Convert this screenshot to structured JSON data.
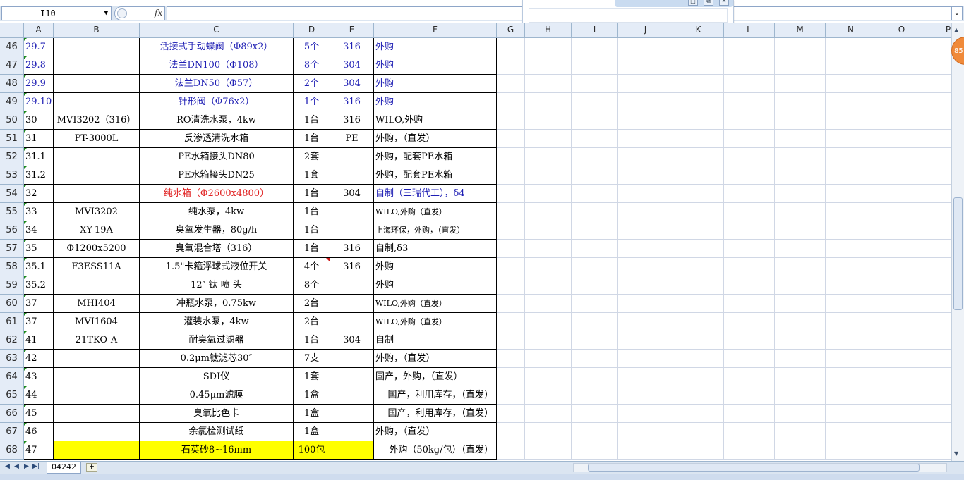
{
  "formula_bar": {
    "name_box": "I10",
    "fx_label": "fx",
    "formula": ""
  },
  "popup": {
    "buttons": [
      "□",
      "⧉",
      "✕"
    ]
  },
  "columns": [
    "A",
    "B",
    "C",
    "D",
    "E",
    "F",
    "G",
    "H",
    "I",
    "J",
    "K",
    "L",
    "M",
    "N",
    "O",
    "P"
  ],
  "rows": [
    {
      "n": "46",
      "a": "29.7",
      "b": "",
      "c": "活接式手动蝶阀（Φ89x2）",
      "d": "5个",
      "e": "316",
      "f": "外购",
      "blue": true
    },
    {
      "n": "47",
      "a": "29.8",
      "b": "",
      "c": "法兰DN100（Φ108）",
      "d": "8个",
      "e": "304",
      "f": "外购",
      "blue": true
    },
    {
      "n": "48",
      "a": "29.9",
      "b": "",
      "c": "法兰DN50（Φ57）",
      "d": "2个",
      "e": "304",
      "f": "外购",
      "blue": true
    },
    {
      "n": "49",
      "a": "29.10",
      "b": "",
      "c": "针形阀（Φ76x2）",
      "d": "1个",
      "e": "316",
      "f": "外购",
      "blue": true
    },
    {
      "n": "50",
      "a": "30",
      "b": "MVI3202（316）",
      "c": "RO清洗水泵，4kw",
      "d": "1台",
      "e": "316",
      "f": "WILO,外购"
    },
    {
      "n": "51",
      "a": "31",
      "b": "PT-3000L",
      "c": "反渗透清洗水箱",
      "d": "1台",
      "e": "PE",
      "f": "外购，（直发）"
    },
    {
      "n": "52",
      "a": "31.1",
      "b": "",
      "c": "PE水箱接头DN80",
      "d": "2套",
      "e": "",
      "f": "外购，配套PE水箱"
    },
    {
      "n": "53",
      "a": "31.2",
      "b": "",
      "c": "PE水箱接头DN25",
      "d": "1套",
      "e": "",
      "f": "外购，配套PE水箱"
    },
    {
      "n": "54",
      "a": "32",
      "b": "",
      "c": "纯水箱（Φ2600x4800）",
      "d": "1台",
      "e": "304",
      "f": "自制（三瑞代工），δ4",
      "red_c": true,
      "blue_ef": true
    },
    {
      "n": "55",
      "a": "33",
      "b": "MVI3202",
      "c": "纯水泵，4kw",
      "d": "1台",
      "e": "",
      "f": "WILO,外购（直发）",
      "small_f": true
    },
    {
      "n": "56",
      "a": "34",
      "b": "XY-19A",
      "c": "臭氧发生器，80g/h",
      "d": "1台",
      "e": "",
      "f": "上海环保，外购，（直发）",
      "small_f": true
    },
    {
      "n": "57",
      "a": "35",
      "b": "Φ1200x5200",
      "c": "臭氧混合塔（316）",
      "d": "1台",
      "e": "316",
      "f": "自制,δ3"
    },
    {
      "n": "58",
      "a": "35.1",
      "b": "F3ESS11A",
      "c": "1.5\"卡箍浮球式液位开关",
      "d": "4个",
      "e": "316",
      "f": "外购"
    },
    {
      "n": "59",
      "a": "35.2",
      "b": "",
      "c": "12″ 钛 喷 头",
      "d": "8个",
      "e": "",
      "f": "外购"
    },
    {
      "n": "60",
      "a": "37",
      "b": "MHI404",
      "c": "冲瓶水泵，0.75kw",
      "d": "2台",
      "e": "",
      "f": "WILO,外购（直发）",
      "small_f": true
    },
    {
      "n": "61",
      "a": "37",
      "b": "MVI1604",
      "c": "灌装水泵，4kw",
      "d": "2台",
      "e": "",
      "f": "WILO,外购（直发）",
      "small_f": true
    },
    {
      "n": "62",
      "a": "41",
      "b": "21TKO-A",
      "c": "耐臭氧过滤器",
      "d": "1台",
      "e": "304",
      "f": "自制"
    },
    {
      "n": "63",
      "a": "42",
      "b": "",
      "c": "0.2μm钛滤芯30″",
      "d": "7支",
      "e": "",
      "f": "外购，（直发）"
    },
    {
      "n": "64",
      "a": "43",
      "b": "",
      "c": "SDI仪",
      "d": "1套",
      "e": "",
      "f": "国产，外购，（直发）"
    },
    {
      "n": "65",
      "a": "44",
      "b": "",
      "c": "0.45μm滤膜",
      "d": "1盒",
      "e": "",
      "f": "国产，利用库存，（直发）",
      "f_spill": true
    },
    {
      "n": "66",
      "a": "45",
      "b": "",
      "c": "臭氧比色卡",
      "d": "1盒",
      "e": "",
      "f": "国产，利用库存，（直发）",
      "f_spill": true
    },
    {
      "n": "67",
      "a": "46",
      "b": "",
      "c": "余氯检测试纸",
      "d": "1盒",
      "e": "",
      "f": "外购，（直发）"
    },
    {
      "n": "68",
      "a": "47",
      "b": "",
      "c": "石英砂8~16mm",
      "d": "100包",
      "e": "",
      "f": "外购（50kg/包）（直发）",
      "yellow": true,
      "f_spill": true
    }
  ],
  "sheet_tabs": [
    "04242"
  ],
  "side_badge": "85",
  "colors": {
    "header_bg": "#e4ecf7",
    "blue_text": "#1f1fb4",
    "red_text": "#e02020",
    "highlight": "#ffff00"
  }
}
